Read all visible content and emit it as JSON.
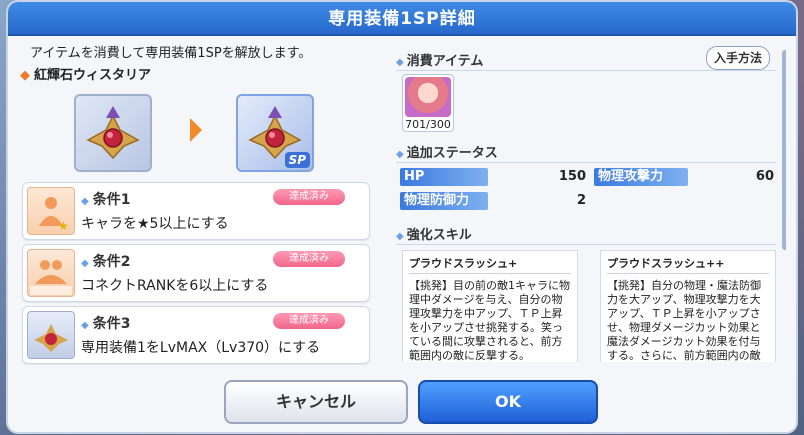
{
  "dialog": {
    "title": "専用装備1SP詳細",
    "description": "アイテムを消費して専用装備1SPを解放します。",
    "item_name": "紅輝石ウィスタリア",
    "sp_tag": "SP"
  },
  "conditions": [
    {
      "label": "条件1",
      "text": "キャラを★5以上にする",
      "badge": "達成済み"
    },
    {
      "label": "条件2",
      "text": "コネクトRANKを6以上にする",
      "badge": "達成済み"
    },
    {
      "label": "条件3",
      "text": "専用装備1をLvMAX（Lv370）にする",
      "badge": "達成済み"
    }
  ],
  "consume": {
    "title": "消費アイテム",
    "how_to_get": "入手方法",
    "count": "701/300"
  },
  "status": {
    "title": "追加ステータス",
    "items": [
      {
        "name": "HP",
        "value": "150"
      },
      {
        "name": "物理攻撃力",
        "value": "60"
      },
      {
        "name": "物理防御力",
        "value": "2"
      }
    ]
  },
  "skills": {
    "title": "強化スキル",
    "cards": [
      {
        "name": "プラウドスラッシュ+",
        "desc": "【挑発】目の前の敵1キャラに物理中ダメージを与え、自分の物理攻撃力を中アップ、ＴＰ上昇を小アップさせ挑発する。笑っている間に攻撃されると、前方範囲内の敵に反撃する。"
      },
      {
        "name": "プラウドスラッシュ++",
        "desc": "【挑発】自分の物理・魔法防御力を大アップ、物理攻撃力を大アップ、ＴＰ上昇を小アップさせ、物理ダメージカット効果と魔法ダメージカット効果を付与する。さらに、前方範囲内の敵"
      }
    ]
  },
  "buttons": {
    "cancel": "キャンセル",
    "ok": "OK"
  },
  "colors": {
    "title_bar": "#2f78dc",
    "accent_orange": "#f08a2a",
    "badge_pink": "#f0658b",
    "stat_blue": "#3a7ae0"
  }
}
